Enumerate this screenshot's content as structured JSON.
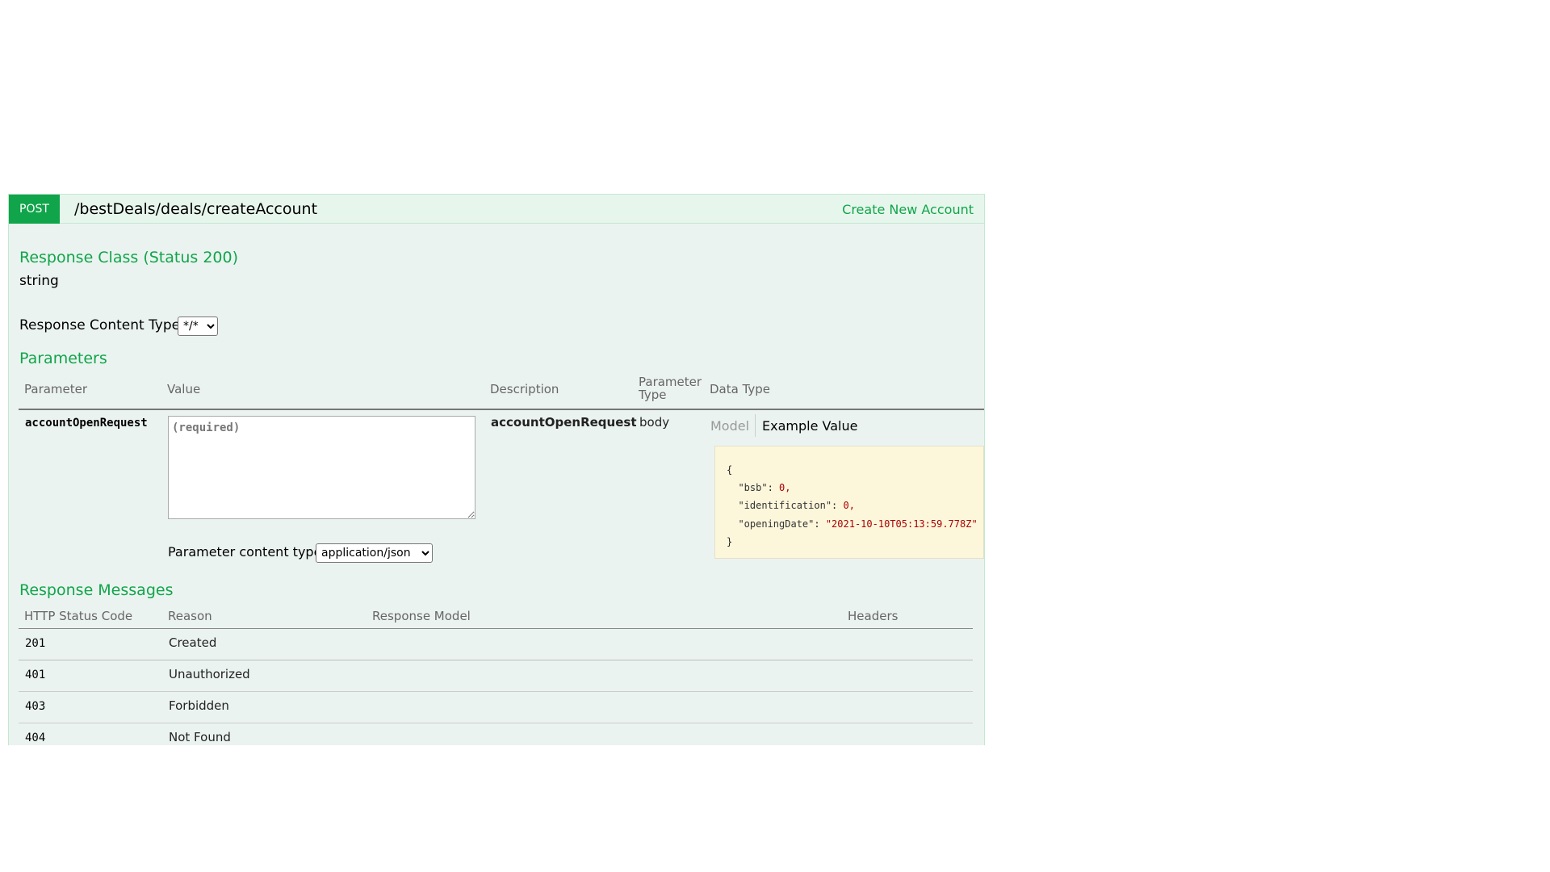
{
  "operation": {
    "method": "POST",
    "path": "/bestDeals/deals/createAccount",
    "summary": "Create New Account"
  },
  "response_class": {
    "title": "Response Class (Status 200)",
    "type": "string"
  },
  "response_content_type": {
    "label": "Response Content Type",
    "selected": "*/*"
  },
  "parameters": {
    "title": "Parameters",
    "headers": {
      "parameter": "Parameter",
      "value": "Value",
      "description": "Description",
      "parameter_type_line1": "Parameter",
      "parameter_type_line2": "Type",
      "data_type": "Data Type"
    },
    "row": {
      "name": "accountOpenRequest",
      "placeholder": "(required)",
      "description": "accountOpenRequest",
      "param_type": "body",
      "tab_model": "Model",
      "tab_example": "Example Value",
      "content_type_label": "Parameter content type:",
      "content_type_selected": "application/json"
    },
    "example": {
      "open": "{",
      "lines": [
        {
          "key": "\"bsb\"",
          "value": "0,"
        },
        {
          "key": "\"identification\"",
          "value": "0,"
        },
        {
          "key": "\"openingDate\"",
          "value": "\"2021-10-10T05:13:59.778Z\""
        }
      ],
      "close": "}"
    }
  },
  "response_messages": {
    "title": "Response Messages",
    "headers": {
      "code": "HTTP Status Code",
      "reason": "Reason",
      "model": "Response Model",
      "headers": "Headers"
    },
    "rows": [
      {
        "code": "201",
        "reason": "Created"
      },
      {
        "code": "401",
        "reason": "Unauthorized"
      },
      {
        "code": "403",
        "reason": "Forbidden"
      },
      {
        "code": "404",
        "reason": "Not Found"
      }
    ]
  },
  "colors": {
    "accent_green": "#10a54a",
    "panel_bg": "#ebf3f0",
    "example_bg": "#fcf6db"
  }
}
